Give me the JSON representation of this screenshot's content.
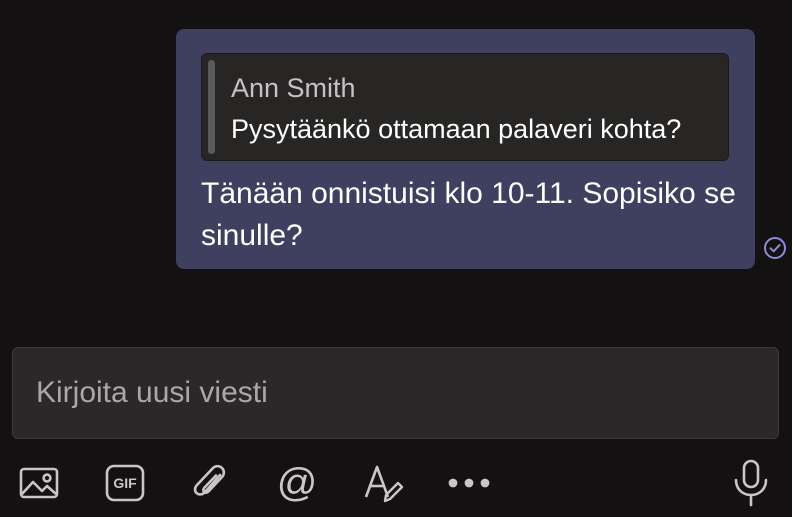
{
  "conversation": {
    "message": {
      "quote": {
        "author": "Ann Smith",
        "text": "Pysytäänkö ottamaan palaveri kohta?"
      },
      "text": "Tänään onnistuisi klo 10-11. Sopisiko se sinulle?",
      "status_icon": "seen-check-icon"
    }
  },
  "composer": {
    "placeholder": "Kirjoita uusi viesti",
    "value": ""
  },
  "toolbar": {
    "buttons": [
      {
        "icon": "image-icon"
      },
      {
        "icon": "gif-icon",
        "label": "GIF"
      },
      {
        "icon": "paperclip-icon"
      },
      {
        "icon": "mention-icon",
        "label": "@"
      },
      {
        "icon": "format-icon"
      },
      {
        "icon": "more-icon"
      },
      {
        "icon": "microphone-icon"
      }
    ]
  },
  "colors": {
    "background": "#131112",
    "bubble": "#3f3f5f",
    "quote_background": "#272625",
    "compose_background": "#2a2828",
    "icon": "#c8c6c6",
    "status_accent": "#8b8bd8"
  }
}
